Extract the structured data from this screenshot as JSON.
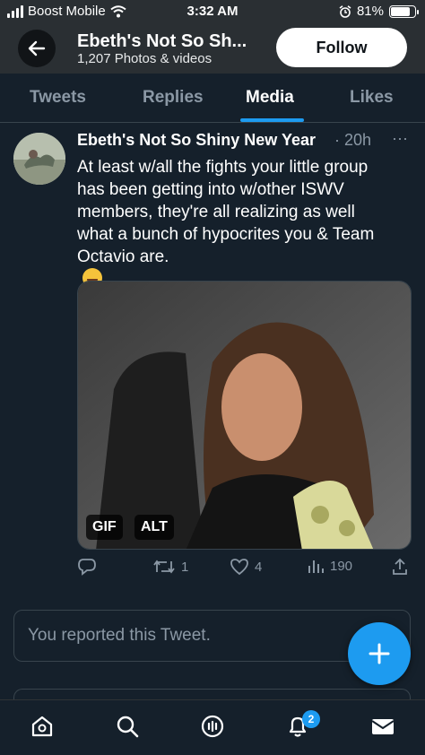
{
  "status_bar": {
    "carrier": "Boost Mobile",
    "time": "3:32 AM",
    "battery": "81%",
    "battery_level": 0.81
  },
  "header": {
    "title": "Ebeth's Not So Sh...",
    "subtitle": "1,207 Photos & videos",
    "follow_label": "Follow",
    "icons": {
      "back": "arrow-left-icon"
    }
  },
  "tabs": [
    {
      "label": "Tweets",
      "active": false
    },
    {
      "label": "Replies",
      "active": false
    },
    {
      "label": "Media",
      "active": true
    },
    {
      "label": "Likes",
      "active": false
    }
  ],
  "tweet": {
    "author_name": "Ebeth's Not So Shiny New Year",
    "time": "· 20h",
    "more": "···",
    "text_lines": [
      "At least w/all the fights your little group",
      "has been getting into w/other ISWV",
      "members, they're all realizing as well",
      "what a bunch of hypocrites you & Team",
      "Octavio are."
    ],
    "emoji": "rolling-on-floor-laughing-emoji",
    "media_badges": {
      "gif": "GIF",
      "alt": "ALT"
    },
    "actions": {
      "reply_count": "",
      "retweet_count": "1",
      "like_count": "4",
      "views_count": "190"
    }
  },
  "reported_notice": "You reported this Tweet.",
  "bottom_nav": {
    "items": [
      "home-icon",
      "search-icon",
      "spaces-icon",
      "notifications-icon",
      "messages-icon"
    ],
    "notification_count": "2"
  },
  "colors": {
    "background": "#15202b",
    "header": "#2a2f33",
    "accent": "#1d9bf0",
    "muted_text": "#8b98a5",
    "border": "#38444d"
  }
}
